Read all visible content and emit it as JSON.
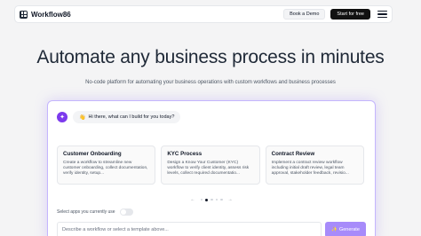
{
  "nav": {
    "brand": "Workflow86",
    "book_demo": "Book a Demo",
    "start_free": "Start for free",
    "menu_icon": "hamburger-menu-icon"
  },
  "hero": {
    "title": "Automate any business process in minutes",
    "subtitle": "No-code platform for automating your business operations with custom workflows and business processes"
  },
  "builder": {
    "avatar_glyph": "✦",
    "greeting_icon": "👋",
    "greeting": "Hi there, what can I build for you today?",
    "templates": [
      {
        "title": "Customer Onboarding",
        "description": "Create a workflow to streamline new customer onboarding, collect documentation, verify identity, setup..."
      },
      {
        "title": "KYC Process",
        "description": "Design a Know Your Customer (KYC) workflow to verify client identity, assess risk levels, collect required documentatio..."
      },
      {
        "title": "Contract Review",
        "description": "Implement a contract review workflow including initial draft review, legal team approval, stakeholder feedback, revisio..."
      }
    ],
    "prev_arrow": "←",
    "next_arrow": "→",
    "select_apps_label": "Select apps you currently use",
    "prompt_placeholder": "Describe a workflow or select a template above...",
    "generate_icon": "✨",
    "generate_label": "Generate"
  },
  "colors": {
    "accent": "#a78bfa",
    "accent_dark": "#7c3aed",
    "brand_dark": "#111111"
  }
}
